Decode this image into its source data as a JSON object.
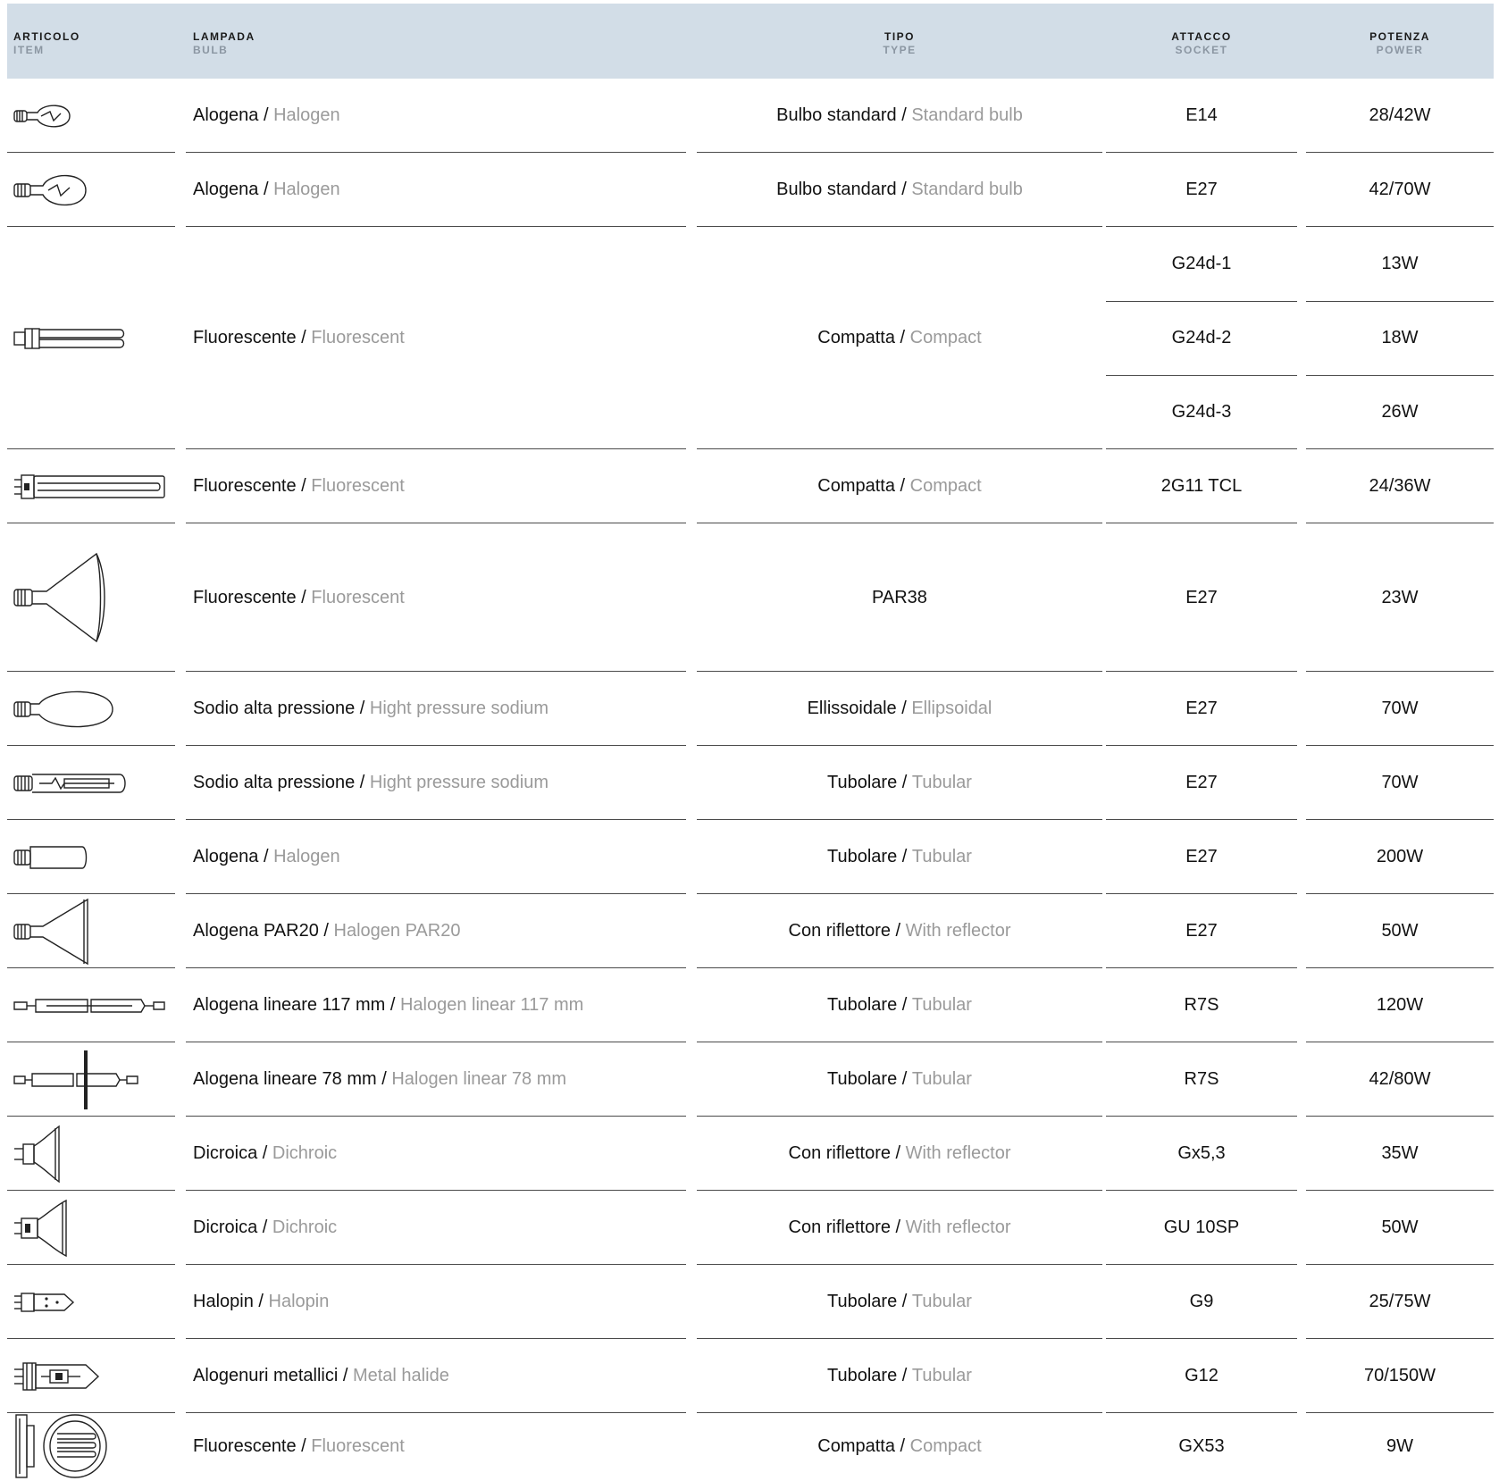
{
  "header": {
    "item_it": "ARTICOLO",
    "item_en": "ITEM",
    "bulb_it": "LAMPADA",
    "bulb_en": "BULB",
    "type_it": "TIPO",
    "type_en": "TYPE",
    "socket_it": "ATTACCO",
    "socket_en": "SOCKET",
    "power_it": "POTENZA",
    "power_en": "POWER"
  },
  "rows": [
    {
      "icon": "halogen-small-bulb-icon",
      "lampada_it": "Alogena",
      "lampada_en": "Halogen",
      "tipo_it": "Bulbo standard",
      "tipo_en": "Standard bulb",
      "sockets": [
        "E14"
      ],
      "powers": [
        "28/42W"
      ]
    },
    {
      "icon": "halogen-standard-bulb-icon",
      "lampada_it": "Alogena",
      "lampada_en": "Halogen",
      "tipo_it": "Bulbo standard",
      "tipo_en": "Standard bulb",
      "sockets": [
        "E27"
      ],
      "powers": [
        "42/70W"
      ]
    },
    {
      "icon": "compact-fluorescent-icon",
      "lampada_it": "Fluorescente",
      "lampada_en": "Fluorescent",
      "tipo_it": "Compatta",
      "tipo_en": "Compact",
      "sockets": [
        "G24d-1",
        "G24d-2",
        "G24d-3"
      ],
      "powers": [
        "13W",
        "18W",
        "26W"
      ]
    },
    {
      "icon": "linear-compact-fluorescent-icon",
      "lampada_it": "Fluorescente",
      "lampada_en": "Fluorescent",
      "tipo_it": "Compatta",
      "tipo_en": "Compact",
      "sockets": [
        "2G11 TCL"
      ],
      "powers": [
        "24/36W"
      ]
    },
    {
      "icon": "par38-reflector-bulb-icon",
      "lampada_it": "Fluorescente",
      "lampada_en": "Fluorescent",
      "tipo_it": "PAR38",
      "tipo_en": "",
      "sockets": [
        "E27"
      ],
      "powers": [
        "23W"
      ]
    },
    {
      "icon": "ellipsoidal-bulb-icon",
      "lampada_it": "Sodio alta pressione",
      "lampada_en": "Hight pressure sodium",
      "tipo_it": "Ellissoidale",
      "tipo_en": "Ellipsoidal",
      "sockets": [
        "E27"
      ],
      "powers": [
        "70W"
      ]
    },
    {
      "icon": "tubular-sodium-bulb-icon",
      "lampada_it": "Sodio alta pressione",
      "lampada_en": "Hight pressure sodium",
      "tipo_it": "Tubolare",
      "tipo_en": "Tubular",
      "sockets": [
        "E27"
      ],
      "powers": [
        "70W"
      ]
    },
    {
      "icon": "tubular-halogen-bulb-icon",
      "lampada_it": "Alogena",
      "lampada_en": "Halogen",
      "tipo_it": "Tubolare",
      "tipo_en": "Tubular",
      "sockets": [
        "E27"
      ],
      "powers": [
        "200W"
      ]
    },
    {
      "icon": "par20-reflector-bulb-icon",
      "lampada_it": "Alogena PAR20",
      "lampada_en": "Halogen PAR20",
      "tipo_it": "Con riflettore",
      "tipo_en": "With reflector",
      "sockets": [
        "E27"
      ],
      "powers": [
        "50W"
      ]
    },
    {
      "icon": "linear-halogen-117-icon",
      "lampada_it": "Alogena lineare 117 mm",
      "lampada_en": "Halogen linear 117 mm",
      "tipo_it": "Tubolare",
      "tipo_en": "Tubular",
      "sockets": [
        "R7S"
      ],
      "powers": [
        "120W"
      ]
    },
    {
      "icon": "linear-halogen-78-icon",
      "lampada_it": "Alogena lineare 78 mm",
      "lampada_en": "Halogen linear 78 mm",
      "tipo_it": "Tubolare",
      "tipo_en": "Tubular",
      "sockets": [
        "R7S"
      ],
      "powers": [
        "42/80W"
      ]
    },
    {
      "icon": "dichroic-gx53-pin-icon",
      "lampada_it": "Dicroica",
      "lampada_en": "Dichroic",
      "tipo_it": "Con riflettore",
      "tipo_en": "With reflector",
      "sockets": [
        "Gx5,3"
      ],
      "powers": [
        "35W"
      ]
    },
    {
      "icon": "dichroic-gu10-icon",
      "lampada_it": "Dicroica",
      "lampada_en": "Dichroic",
      "tipo_it": "Con riflettore",
      "tipo_en": "With reflector",
      "sockets": [
        "GU 10SP"
      ],
      "powers": [
        "50W"
      ]
    },
    {
      "icon": "halopin-bulb-icon",
      "lampada_it": "Halopin",
      "lampada_en": "Halopin",
      "tipo_it": "Tubolare",
      "tipo_en": "Tubular",
      "sockets": [
        "G9"
      ],
      "powers": [
        "25/75W"
      ]
    },
    {
      "icon": "metal-halide-bulb-icon",
      "lampada_it": "Alogenuri metallici",
      "lampada_en": "Metal halide",
      "tipo_it": "Tubolare",
      "tipo_en": "Tubular",
      "sockets": [
        "G12"
      ],
      "powers": [
        "70/150W"
      ]
    },
    {
      "icon": "gx53-disc-fluorescent-icon",
      "lampada_it": "Fluorescente",
      "lampada_en": "Fluorescent",
      "tipo_it": "Compatta",
      "tipo_en": "Compact",
      "sockets": [
        "GX53"
      ],
      "powers": [
        "9W"
      ]
    }
  ]
}
